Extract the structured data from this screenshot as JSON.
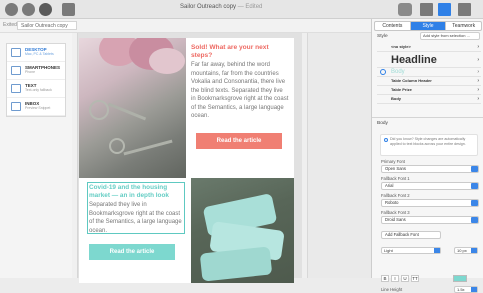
{
  "window": {
    "title": "Sailor Outreach copy",
    "edited": "— Edited"
  },
  "toolbar": {
    "doc_label": "Exited",
    "doc_field": "Sailor Outreach copy",
    "icons": [
      "preview-icon",
      "publish-icon",
      "check-icon",
      "share-icon",
      "cloud-icon",
      "layout-icon",
      "add-icon",
      "sidebar-icon"
    ]
  },
  "devices": [
    {
      "name": "DESKTOP",
      "sub": "Mac, PC & Tablets",
      "active": true
    },
    {
      "name": "SMARTPHONES",
      "sub": "Phone",
      "active": false
    },
    {
      "name": "TEXT",
      "sub": "Text-only fallback",
      "active": false
    },
    {
      "name": "INBOX",
      "sub": "Preview Snippet",
      "active": false
    }
  ],
  "card1": {
    "headline": "Sold! What are your next steps?",
    "body": "Far far away, behind the word mountains, far from the countries Vokalia and Consonantia, there live the blind texts. Separated they live in Bookmarksgrove right at the coast of the Semantics, a large language ocean.",
    "button": "Read the article",
    "accent": "#f07f73"
  },
  "card2": {
    "headline": "Covid-19 and the housing market — an in depth look",
    "body": "Separated they live in Bookmarksgrove right at the coast of the Semantics, a large language ocean.",
    "button": "Read the article",
    "accent": "#7dd8cf"
  },
  "inspector": {
    "tabs": [
      {
        "label": "Contents",
        "active": false
      },
      {
        "label": "Style",
        "active": true
      },
      {
        "label": "Teamwork",
        "active": false
      }
    ],
    "style_label": "Style",
    "style_select": "Add style from selection ...",
    "styles": [
      {
        "label": "<no style>",
        "kind": "small"
      },
      {
        "label": "Headline",
        "kind": "h"
      },
      {
        "label": "Body",
        "kind": "sel"
      },
      {
        "label": "Table Column Header",
        "kind": "small"
      },
      {
        "label": "Table Prize",
        "kind": "small"
      },
      {
        "label": "Body",
        "kind": "small"
      }
    ],
    "body_section": "Body",
    "notice": "Did you know? Style changes are automatically applied to text blocks across your entire design.",
    "primary_font_label": "Primary Font",
    "primary_font": "Open Sans",
    "fallback1_label": "Fallback Font 1",
    "fallback1": "Arial",
    "fallback2_label": "Fallback Font 2",
    "fallback2": "Roboto",
    "fallback3_label": "Fallback Font 3",
    "fallback3": "Droid Sans",
    "add_fallback": "Add Fallback Font",
    "weight": "Light",
    "size": "10 px",
    "format_buttons": [
      "B",
      "I",
      "U",
      "TT"
    ],
    "line_height_label": "Line Height",
    "line_height": "1.5x",
    "accent_color": "#2f80e7"
  }
}
